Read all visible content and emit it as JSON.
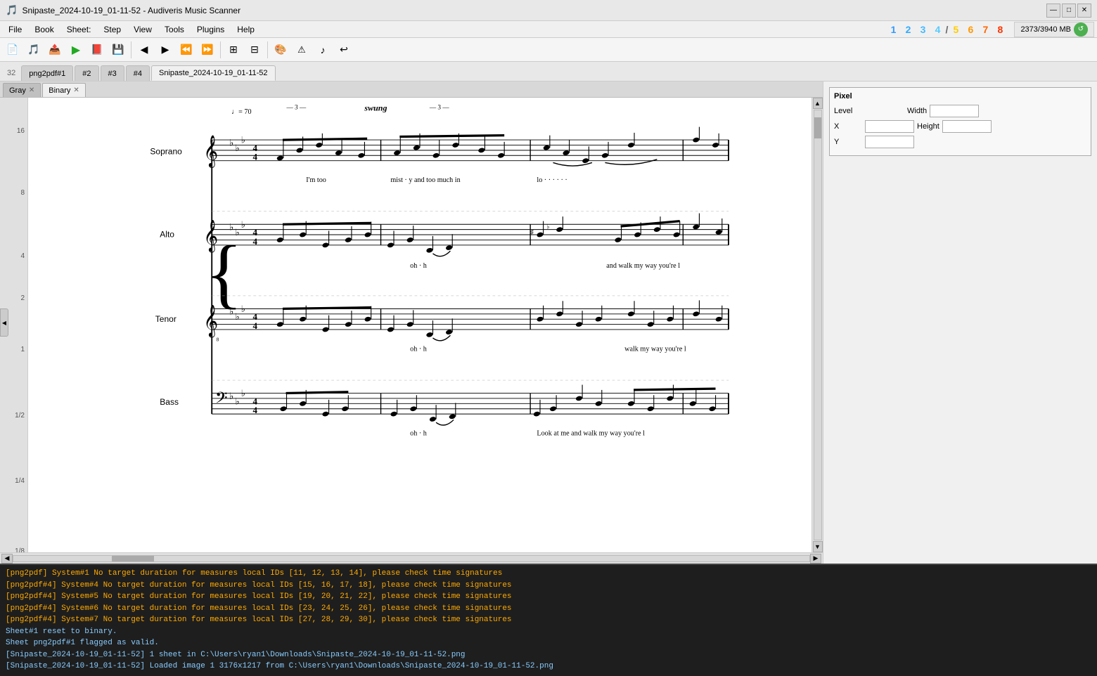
{
  "titleBar": {
    "icon": "🎵",
    "title": "Snipaste_2024-10-19_01-11-52 - Audiveris Music Scanner",
    "minimize": "—",
    "maximize": "□",
    "close": "✕"
  },
  "menuBar": {
    "items": [
      "File",
      "Book",
      "Sheet:",
      "Step",
      "View",
      "Tools",
      "Plugins",
      "Help"
    ]
  },
  "steps": {
    "nums": [
      "1",
      "2",
      "3",
      "4",
      "/",
      "5",
      "6",
      "7",
      "8"
    ],
    "colors": [
      "#3399ff",
      "#33aaff",
      "#44bbff",
      "#55ccff",
      "#888888",
      "#ffcc00",
      "#ff9900",
      "#ff6600",
      "#ff3300"
    ]
  },
  "memory": {
    "label": "2373/3940 MB"
  },
  "toolbar": {
    "buttons": [
      "📄",
      "🎵",
      "📤",
      "▶",
      "📕",
      "💾",
      "◀",
      "▶",
      "⏪",
      "⏩",
      "⊞",
      "⊟",
      "🎨",
      "⚠",
      "♪",
      "↩"
    ]
  },
  "fileTabs": {
    "tabs": [
      {
        "label": "png2pdf#1",
        "active": false
      },
      {
        "label": "#2",
        "active": false
      },
      {
        "label": "#3",
        "active": false
      },
      {
        "label": "#4",
        "active": false
      },
      {
        "label": "Snipaste_2024-10-19_01-11-52",
        "active": true
      }
    ],
    "pageNum": "32"
  },
  "viewTabs": [
    {
      "label": "Gray",
      "closable": true,
      "active": false
    },
    {
      "label": "Binary",
      "closable": true,
      "active": true
    }
  ],
  "pixelPanel": {
    "title": "Pixel",
    "levelLabel": "Level",
    "xLabel": "X",
    "yLabel": "Y",
    "widthLabel": "Width",
    "heightLabel": "Height",
    "xValue": "",
    "yValue": "",
    "widthValue": "",
    "heightValue": ""
  },
  "scaleMarks": [
    "16",
    "8",
    "4",
    "2",
    "1",
    "1/2",
    "1/4",
    "1/8"
  ],
  "scalePositions": [
    40,
    130,
    210,
    290,
    360,
    455,
    555,
    680
  ],
  "notation": {
    "tempo": "♩= 70",
    "style": "swung",
    "triplet1": "— 3 —",
    "triplet2": "— 3 —",
    "voices": [
      {
        "name": "Soprano",
        "lyrics": "I'm too   mist · y and too much in   lo   ·   ·   ·   ·   ·   ·"
      },
      {
        "name": "Alto",
        "lyrics": "oh   ·   h                                                    and walk my   way you're l"
      },
      {
        "name": "Tenor",
        "lyrics": "oh   ·   h                                                    walk my   way you're l"
      },
      {
        "name": "Bass",
        "lyrics": "oh   ·   h   Look at me and walk my   way you're l"
      }
    ]
  },
  "logLines": [
    {
      "text": "[png2pdf] System#1 No target duration for measures local IDs [11, 12, 13, 14], please check time signatures",
      "type": "warning"
    },
    {
      "text": "[png2pdf#4] System#4 No target duration for measures local IDs [15, 16, 17, 18], please check time signatures",
      "type": "warning"
    },
    {
      "text": "[png2pdf#4] System#5 No target duration for measures local IDs [19, 20, 21, 22], please check time signatures",
      "type": "warning"
    },
    {
      "text": "[png2pdf#4] System#6 No target duration for measures local IDs [23, 24, 25, 26], please check time signatures",
      "type": "warning"
    },
    {
      "text": "[png2pdf#4] System#7 No target duration for measures local IDs [27, 28, 29, 30], please check time signatures",
      "type": "warning"
    },
    {
      "text": "Sheet#1 reset to binary.",
      "type": "info"
    },
    {
      "text": "Sheet png2pdf#1 flagged as valid.",
      "type": "info"
    },
    {
      "text": "[Snipaste_2024-10-19_01-11-52] 1 sheet in C:\\Users\\ryan1\\Downloads\\Snipaste_2024-10-19_01-11-52.png",
      "type": "info"
    },
    {
      "text": "[Snipaste_2024-10-19_01-11-52] Loaded image 1 3176x1217 from C:\\Users\\ryan1\\Downloads\\Snipaste_2024-10-19_01-11-52.png",
      "type": "info"
    }
  ]
}
